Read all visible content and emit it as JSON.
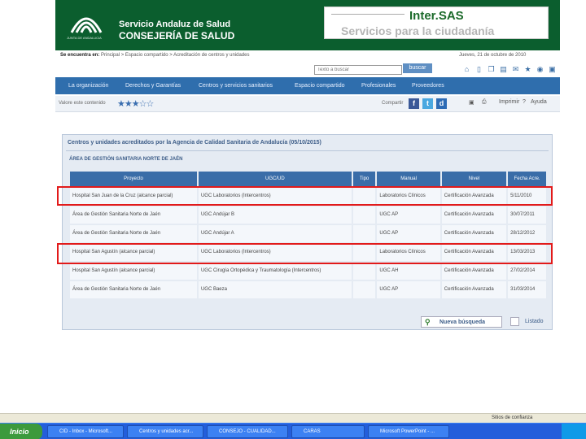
{
  "header": {
    "org_line1": "Servicio Andaluz de Salud",
    "org_line2": "CONSEJERÍA DE SALUD",
    "org_small": "JUNTA DE ANDALUCIA",
    "intersas_title": "Inter.SAS",
    "intersas_subtitle": "Servicios para la ciudadanía"
  },
  "breadcrumb": {
    "prefix": "Se encuentra en:",
    "path": "Principal > Espacio compartido > Acreditación de centros y unidades",
    "date": "Jueves, 21 de octubre de 2010"
  },
  "search": {
    "placeholder": "Texto a buscar",
    "button": "buscar"
  },
  "nav": [
    "La organización",
    "Derechos y Garantías",
    "Centros y servicios sanitarios",
    "Espacio compartido",
    "Profesionales",
    "Proveedores"
  ],
  "rating": {
    "label": "Valore este contenido",
    "stars": "★★★☆☆",
    "share_label": "Compartir",
    "print": "Imprimir",
    "help": "Ayuda"
  },
  "panel": {
    "title": "Centros y unidades acreditados por la Agencia de Calidad Sanitaria de Andalucía (05/10/2015)",
    "area": "ÁREA DE GESTIÓN SANITARIA NORTE DE JAÉN",
    "columns": [
      "Proyecto",
      "UGC/UD",
      "Tipo",
      "Manual",
      "Nivel",
      "Fecha Acre."
    ],
    "rows": [
      [
        "Hospital San Juan de la Cruz (alcance parcial)",
        "UGC Laboratorios (Intercentros)",
        "",
        "Laboratorios Clínicos",
        "Certificación Avanzada",
        "5/11/2010"
      ],
      [
        "Área de Gestión Sanitaria Norte de Jaén",
        "UGC Andújar B",
        "",
        "UGC AP",
        "Certificación Avanzada",
        "30/07/2011"
      ],
      [
        "Área de Gestión Sanitaria Norte de Jaén",
        "UGC Andújar A",
        "",
        "UGC AP",
        "Certificación Avanzada",
        "28/12/2012"
      ],
      [
        "Hospital San Agustín (alcance parcial)",
        "UGC Laboratorios (Intercentros)",
        "",
        "Laboratorios Clínicos",
        "Certificación Avanzada",
        "13/03/2013"
      ],
      [
        "Hospital San Agustín (alcance parcial)",
        "UGC Cirugía Ortopédica y Traumatología (Intercentros)",
        "",
        "UGC AH",
        "Certificación Avanzada",
        "27/02/2014"
      ],
      [
        "Área de Gestión Sanitaria Norte de Jaén",
        "UGC Baeza",
        "",
        "UGC AP",
        "Certificación Avanzada",
        "31/03/2014"
      ]
    ],
    "new_search": "Nueva búsqueda",
    "listado": "Listado"
  },
  "statusbar": {
    "text": "Sitios de confianza"
  },
  "taskbar": {
    "start": "Inicio",
    "items": [
      "CID - Inbox - Microsoft...",
      "Centros y unidades acr...",
      "CONSEJO - CUALIDAD...",
      "CARAS",
      "Microsoft PowerPoint - ..."
    ]
  },
  "colors": {
    "header_green": "#0b5e2e",
    "nav_blue": "#2f6ead",
    "highlight_red": "#e21a1a"
  }
}
